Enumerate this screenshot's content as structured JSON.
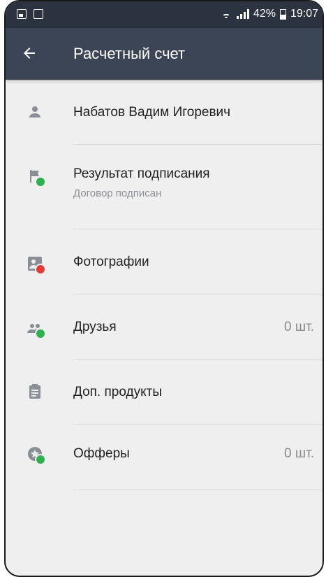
{
  "statusbar": {
    "battery": "42%",
    "time": "19:07"
  },
  "appbar": {
    "title": "Расчетный счет"
  },
  "items": [
    {
      "label": "Набатов Вадим Игоревич",
      "subtitle": "",
      "count": ""
    },
    {
      "label": "Результат подписания",
      "subtitle": "Договор подписан",
      "count": ""
    },
    {
      "label": "Фотографии",
      "subtitle": "",
      "count": ""
    },
    {
      "label": "Друзья",
      "subtitle": "",
      "count": "0 шт."
    },
    {
      "label": "Доп. продукты",
      "subtitle": "",
      "count": ""
    },
    {
      "label": "Офферы",
      "subtitle": "",
      "count": "0 шт."
    }
  ],
  "colors": {
    "appbar": "#3b4555",
    "statusbar": "#2b3340",
    "icon_gray": "#8a8f96",
    "ok_green": "#2bb24c",
    "error_red": "#e53935"
  },
  "icons": [
    "person-icon",
    "flag-check-icon",
    "photo-alert-icon",
    "friends-check-icon",
    "clipboard-icon",
    "offer-check-icon"
  ]
}
